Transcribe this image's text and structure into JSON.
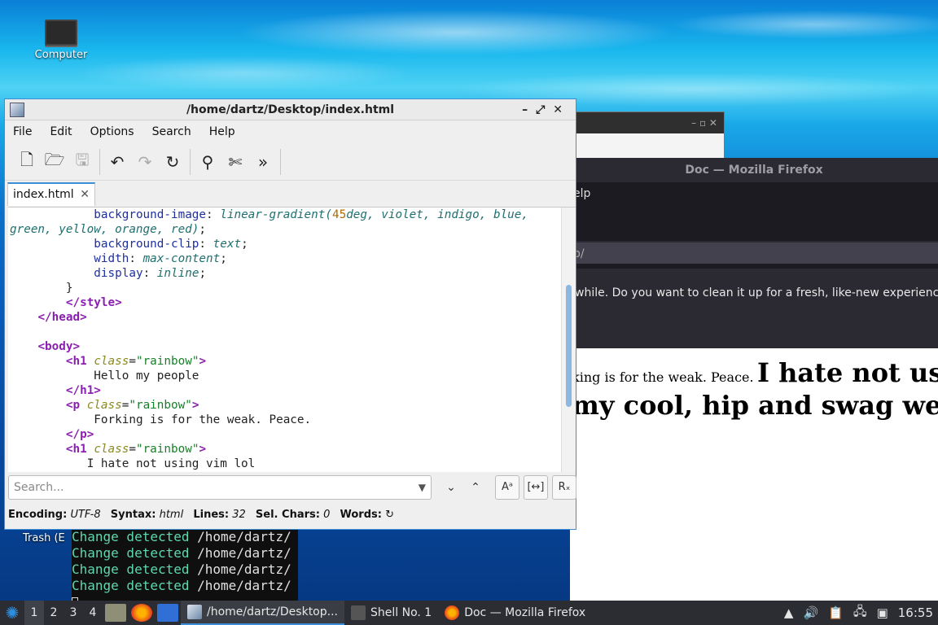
{
  "desktop": {
    "computer_label": "Computer",
    "trash_label": "Trash (E"
  },
  "terminal": {
    "lines": [
      {
        "text": "Change detected ",
        "path": "/home/dartz/"
      },
      {
        "text": "Change detected ",
        "path": "/home/dartz/"
      },
      {
        "text": "Change detected ",
        "path": "/home/dartz/"
      },
      {
        "text": "Change detected ",
        "path": "/home/dartz/"
      }
    ]
  },
  "firefox": {
    "title": "Doc — Mozilla Firefox",
    "menu_fragment": "elp",
    "url_fragment": "p/",
    "notice_fragment": "while. Do you want to clean it up for a fresh, like-new experience? A",
    "content_small": "king is for the weak. Peace.",
    "content_big_1": "I hate not us",
    "content_big_2": "my cool, hip and swag we"
  },
  "editor": {
    "title": "/home/dartz/Desktop/index.html",
    "menu": [
      "File",
      "Edit",
      "Options",
      "Search",
      "Help"
    ],
    "tab_label": "index.html",
    "search_placeholder": "Search...",
    "status": {
      "encoding_label": "Encoding:",
      "encoding_value": "UTF-8",
      "syntax_label": "Syntax:",
      "syntax_value": "html",
      "lines_label": "Lines:",
      "lines_value": "32",
      "selchars_label": "Sel. Chars:",
      "selchars_value": "0",
      "words_label": "Words:"
    }
  },
  "taskbar": {
    "workspaces": [
      "1",
      "2",
      "3",
      "4"
    ],
    "tasks": [
      {
        "label": "/home/dartz/Desktop..."
      },
      {
        "label": "Shell No. 1"
      },
      {
        "label": "Doc — Mozilla Firefox"
      }
    ],
    "clock": "16:55"
  }
}
